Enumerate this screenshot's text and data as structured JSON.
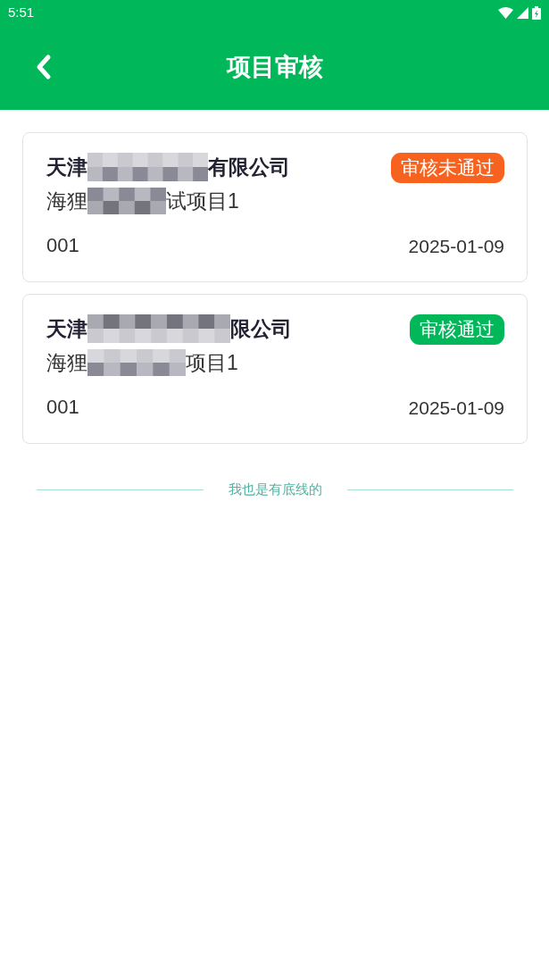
{
  "status_bar": {
    "time": "5:51"
  },
  "header": {
    "title": "项目审核"
  },
  "projects": [
    {
      "company_head": "天津",
      "company_tail": "有限公司",
      "project_head": "海狸",
      "project_tail": "试项目1",
      "code": "001",
      "date": "2025-01-09",
      "status": {
        "label": "审核未通过",
        "kind": "rejected"
      }
    },
    {
      "company_head": "天津",
      "company_tail": "限公司",
      "project_head": "海狸",
      "project_tail": "项目1",
      "code": "001",
      "date": "2025-01-09",
      "status": {
        "label": "审核通过",
        "kind": "approved"
      }
    }
  ],
  "footer_divider": {
    "label": "我也是有底线的"
  }
}
